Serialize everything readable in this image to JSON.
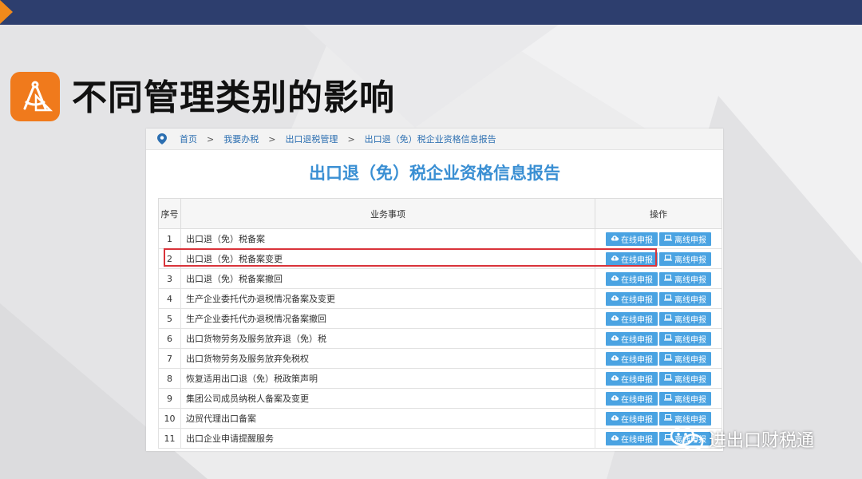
{
  "slide": {
    "title": "不同管理类别的影响",
    "colors": {
      "top_bar": "#2d3e6e",
      "accent": "#f08a1c",
      "logo_bg": "#f07a1c",
      "title_blue": "#3a8fd3",
      "button": "#4aa3e2",
      "highlight": "#d9333a"
    }
  },
  "breadcrumb": {
    "icon": "location-pin-icon",
    "items": [
      "首页",
      "我要办税",
      "出口退税管理",
      "出口退（免）税企业资格信息报告"
    ],
    "separator": ">"
  },
  "report_title": "出口退（免）税企业资格信息报告",
  "table": {
    "headers": {
      "num": "序号",
      "item": "业务事项",
      "ops": "操作"
    },
    "rows": [
      {
        "num": "1",
        "item": "出口退（免）税备案"
      },
      {
        "num": "2",
        "item": "出口退（免）税备案变更",
        "highlighted": true
      },
      {
        "num": "3",
        "item": "出口退（免）税备案撤回"
      },
      {
        "num": "4",
        "item": "生产企业委托代办退税情况备案及变更"
      },
      {
        "num": "5",
        "item": "生产企业委托代办退税情况备案撤回"
      },
      {
        "num": "6",
        "item": "出口货物劳务及服务放弃退（免）税"
      },
      {
        "num": "7",
        "item": "出口货物劳务及服务放弃免税权"
      },
      {
        "num": "8",
        "item": "恢复适用出口退（免）税政策声明"
      },
      {
        "num": "9",
        "item": "集团公司成员纳税人备案及变更"
      },
      {
        "num": "10",
        "item": "边贸代理出口备案"
      },
      {
        "num": "11",
        "item": "出口企业申请提醒服务"
      }
    ],
    "online_label": "在线申报",
    "offline_label": "离线申报",
    "online_icon": "cloud-upload-icon",
    "offline_icon": "laptop-icon"
  },
  "watermark": {
    "text": "进出口财税通",
    "icon": "wechat-icon"
  }
}
